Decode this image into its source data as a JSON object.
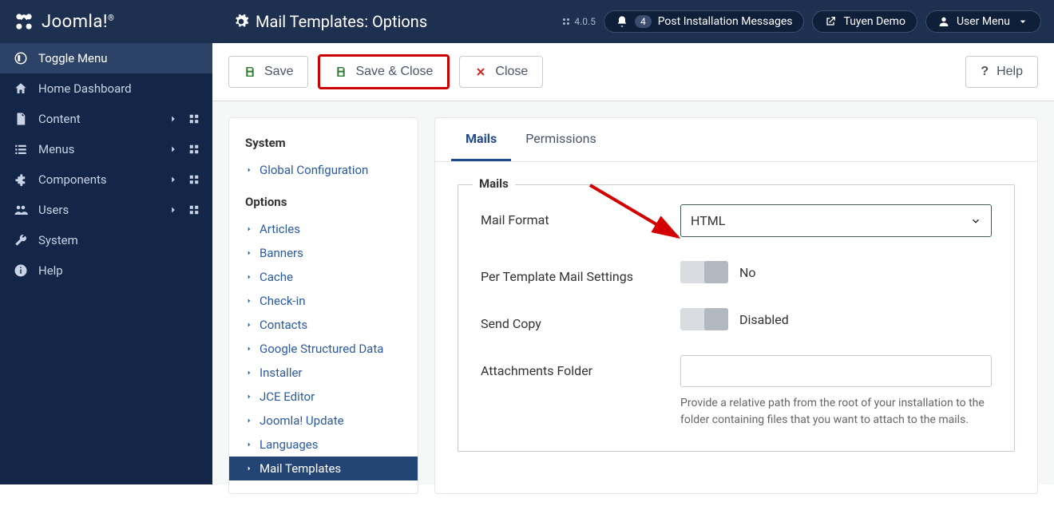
{
  "brand": "Joomla!",
  "page_title": "Mail Templates: Options",
  "version": "4.0.5",
  "header_pills": {
    "notif_count": "4",
    "notif_label": "Post Installation Messages",
    "site_label": "Tuyen Demo",
    "user_label": "User Menu"
  },
  "sidebar": [
    {
      "icon": "toggle",
      "label": "Toggle Menu",
      "active": true,
      "expand": false
    },
    {
      "icon": "home",
      "label": "Home Dashboard",
      "expand": false
    },
    {
      "icon": "file",
      "label": "Content",
      "expand": true
    },
    {
      "icon": "list",
      "label": "Menus",
      "expand": true
    },
    {
      "icon": "puzzle",
      "label": "Components",
      "expand": true
    },
    {
      "icon": "users",
      "label": "Users",
      "expand": true
    },
    {
      "icon": "wrench",
      "label": "System",
      "expand": false
    },
    {
      "icon": "info",
      "label": "Help",
      "expand": false
    }
  ],
  "actions": {
    "save": "Save",
    "save_close": "Save & Close",
    "close": "Close",
    "help": "Help"
  },
  "left_panel": {
    "h1": "System",
    "sys_items": [
      "Global Configuration"
    ],
    "h2": "Options",
    "opt_items": [
      "Articles",
      "Banners",
      "Cache",
      "Check-in",
      "Contacts",
      "Google Structured Data",
      "Installer",
      "JCE Editor",
      "Joomla! Update",
      "Languages",
      "Mail Templates"
    ]
  },
  "tabs": [
    "Mails",
    "Permissions"
  ],
  "fieldset_title": "Mails",
  "form": {
    "mail_format_label": "Mail Format",
    "mail_format_value": "HTML",
    "per_template_label": "Per Template Mail Settings",
    "per_template_value": "No",
    "send_copy_label": "Send Copy",
    "send_copy_value": "Disabled",
    "attach_label": "Attachments Folder",
    "attach_value": "",
    "attach_help": "Provide a relative path from the root of your installation to the folder containing files that you want to attach to the mails."
  }
}
